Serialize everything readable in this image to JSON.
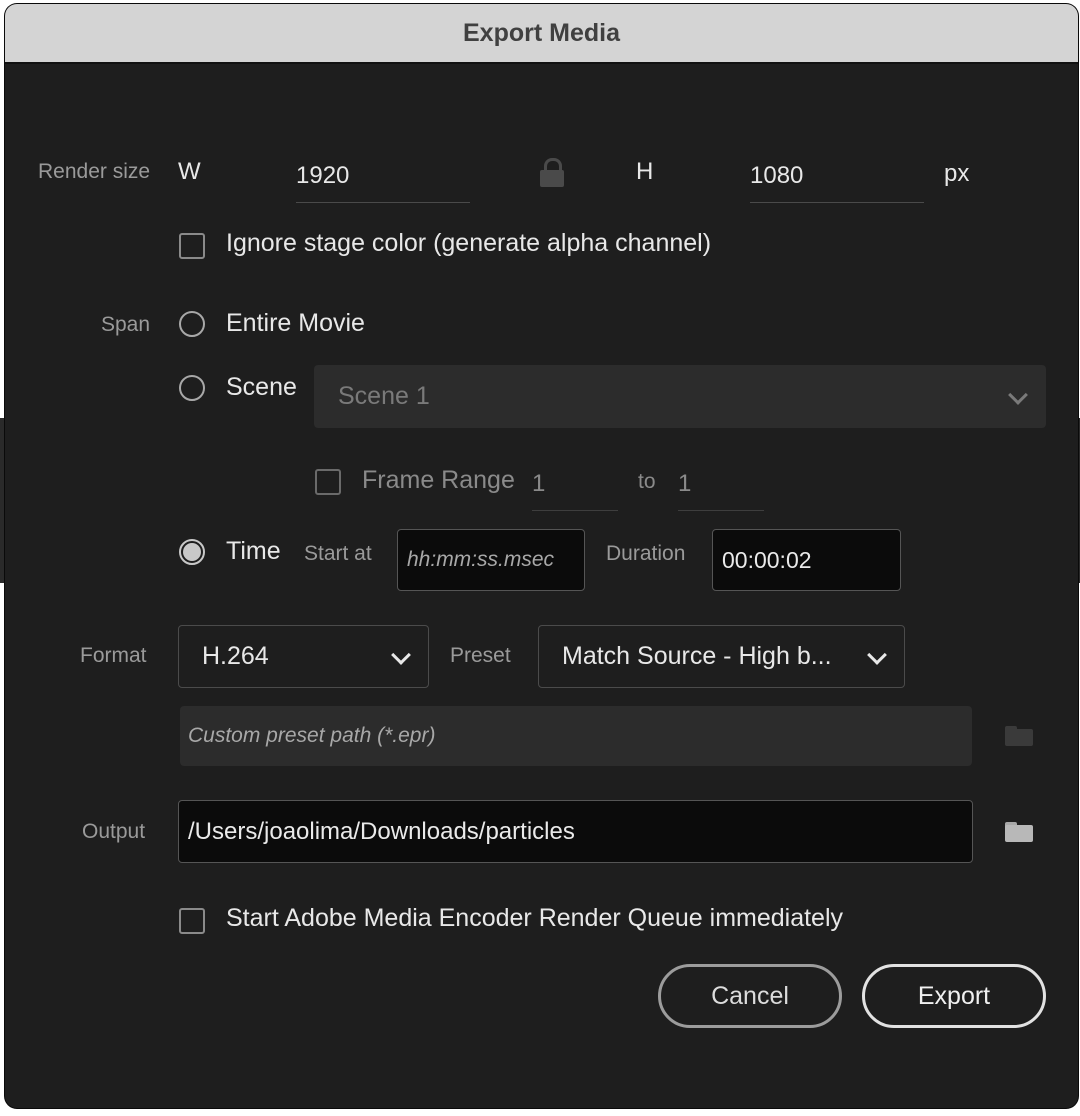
{
  "window": {
    "title": "Export Media"
  },
  "render_size": {
    "label": "Render size",
    "w_label": "W",
    "width": "1920",
    "h_label": "H",
    "height": "1080",
    "unit": "px"
  },
  "ignore_stage": {
    "label": "Ignore stage color (generate alpha channel)",
    "checked": false
  },
  "span": {
    "label": "Span",
    "entire_movie": "Entire Movie",
    "scene": "Scene",
    "scene_select": "Scene 1",
    "frame_range": {
      "label": "Frame Range",
      "from": "1",
      "to_label": "to",
      "to": "1",
      "checked": false
    },
    "time": "Time",
    "start_at_label": "Start at",
    "start_at_placeholder": "hh:mm:ss.msec",
    "duration_label": "Duration",
    "duration_value": "00:00:02",
    "selected": "time"
  },
  "format": {
    "label": "Format",
    "value": "H.264",
    "preset_label": "Preset",
    "preset_value": "Match Source - High b...",
    "custom_preset_placeholder": "Custom preset path (*.epr)"
  },
  "output": {
    "label": "Output",
    "path": "/Users/joaolima/Downloads/particles"
  },
  "ame_queue": {
    "label": "Start Adobe Media Encoder Render Queue immediately",
    "checked": false
  },
  "buttons": {
    "cancel": "Cancel",
    "export": "Export"
  },
  "icons": {
    "lock": "lock-icon",
    "folder": "folder-icon",
    "chevron": "chevron-down-icon"
  }
}
